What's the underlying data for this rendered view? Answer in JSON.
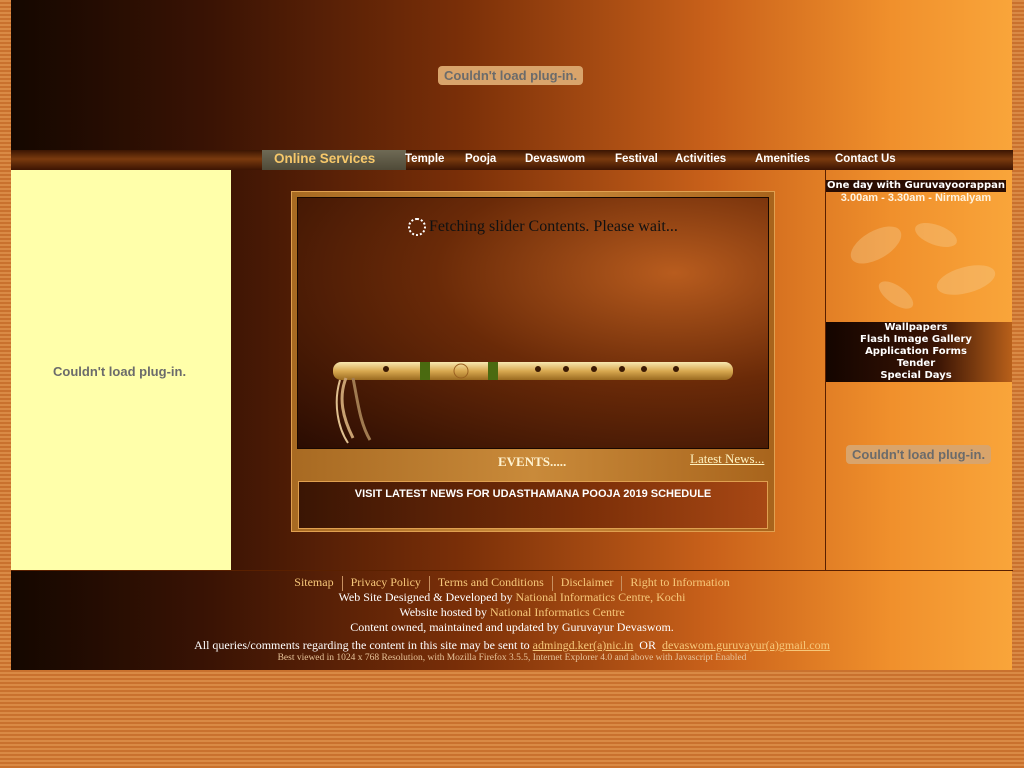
{
  "header": {
    "plugin_message": "Couldn't load plug-in."
  },
  "nav": {
    "items": [
      "Online Services",
      "Temple",
      "Pooja",
      "Devaswom",
      "Festival",
      "Activities",
      "Amenities",
      "Contact Us"
    ]
  },
  "left_panel": {
    "plugin_message": "Couldn't load plug-in."
  },
  "slider": {
    "loading_text": "Fetching slider Contents. Please wait...",
    "events_label": "EVENTS.....",
    "latest_news_link": "Latest News...",
    "news_text": "VISIT LATEST NEWS FOR UDASTHAMANA POOJA 2019 SCHEDULE"
  },
  "right_panel": {
    "oneday_title": "One day with Guruvayoorappan",
    "oneday_time": "3.00am - 3.30am - Nirmalyam",
    "quick_links": [
      "Wallpapers",
      "Flash Image Gallery",
      "Application Forms",
      "Tender",
      "Special Days"
    ],
    "plugin_message": "Couldn't load plug-in."
  },
  "footer": {
    "links": [
      "Sitemap",
      "Privacy Policy",
      "Terms and Conditions",
      "Disclaimer",
      "Right to Information"
    ],
    "designed_prefix": "Web Site Designed & Developed by ",
    "designed_by": "National Informatics Centre, Kochi",
    "hosted_prefix": "Website hosted by ",
    "hosted_by": "National Informatics Centre",
    "owned_text": "Content owned, maintained and updated by Guruvayur Devaswom.",
    "queries_prefix": "All queries/comments regarding the content in this site may be sent to ",
    "email1": "admingd.ker(a)nic.in",
    "or_text": "OR",
    "email2": "devaswom.guruvayur(a)gmail.com",
    "best_viewed": "Best viewed in 1024 x 768 Resolution, with Mozilla Firefox 3.5.5, Internet Explorer 4.0 and above with Javascript Enabled"
  }
}
